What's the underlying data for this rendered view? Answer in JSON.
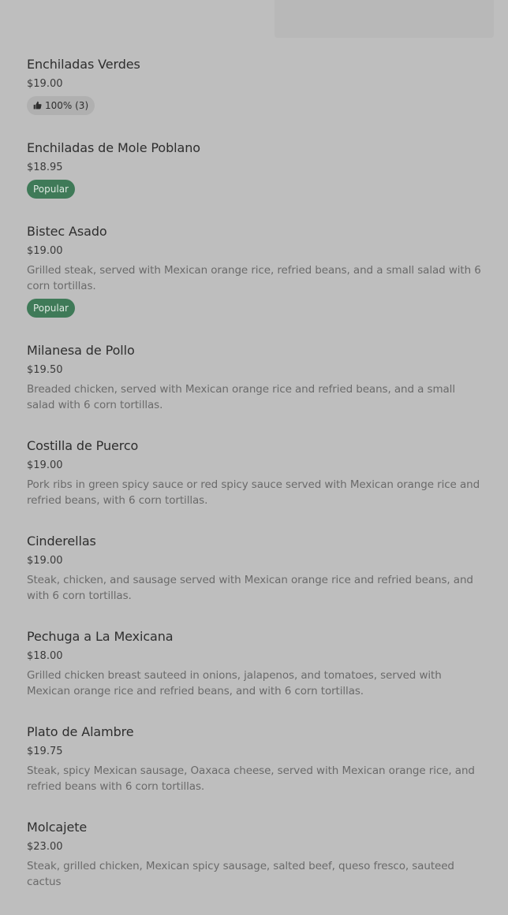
{
  "menu": {
    "items": [
      {
        "name": "Enchiladas Verdes",
        "price": "$19.00",
        "description": "",
        "badge": "100% (3)",
        "badge_type": "rating"
      },
      {
        "name": "Enchiladas de Mole Poblano",
        "price": "$18.95",
        "description": "",
        "badge": "Popular",
        "badge_type": "popular"
      },
      {
        "name": "Bistec Asado",
        "price": "$19.00",
        "description": "Grilled steak, served with Mexican orange rice, refried beans, and a small salad with 6 corn tortillas.",
        "badge": "Popular",
        "badge_type": "popular"
      },
      {
        "name": "Milanesa de Pollo",
        "price": "$19.50",
        "description": "Breaded chicken, served with Mexican orange rice and refried beans, and a small salad with 6 corn tortillas.",
        "badge": "",
        "badge_type": ""
      },
      {
        "name": "Costilla de Puerco",
        "price": "$19.00",
        "description": "Pork ribs in green spicy sauce or red spicy sauce served with Mexican orange rice and refried beans, with 6 corn tortillas.",
        "badge": "",
        "badge_type": ""
      },
      {
        "name": "Cinderellas",
        "price": "$19.00",
        "description": "Steak, chicken, and sausage served with Mexican orange rice and refried beans, and with 6 corn tortillas.",
        "badge": "",
        "badge_type": ""
      },
      {
        "name": "Pechuga a La Mexicana",
        "price": "$18.00",
        "description": "Grilled chicken breast sauteed in onions, jalapenos, and tomatoes, served with Mexican orange rice and refried beans, and with 6 corn tortillas.",
        "badge": "",
        "badge_type": ""
      },
      {
        "name": "Plato de Alambre",
        "price": "$19.75",
        "description": "Steak, spicy Mexican sausage, Oaxaca cheese, served with Mexican orange rice, and refried beans with 6 corn tortillas.",
        "badge": "",
        "badge_type": ""
      },
      {
        "name": "Molcajete",
        "price": "$23.00",
        "description": "Steak, grilled chicken, Mexican spicy sausage, salted beef, queso fresco, sauteed cactus",
        "badge": "",
        "badge_type": ""
      }
    ]
  },
  "icons": {
    "rating_icon": "thumbs-up-icon"
  },
  "colors": {
    "popular_badge_bg": "#3f7a58",
    "rating_badge_bg": "#b0b0b0"
  }
}
